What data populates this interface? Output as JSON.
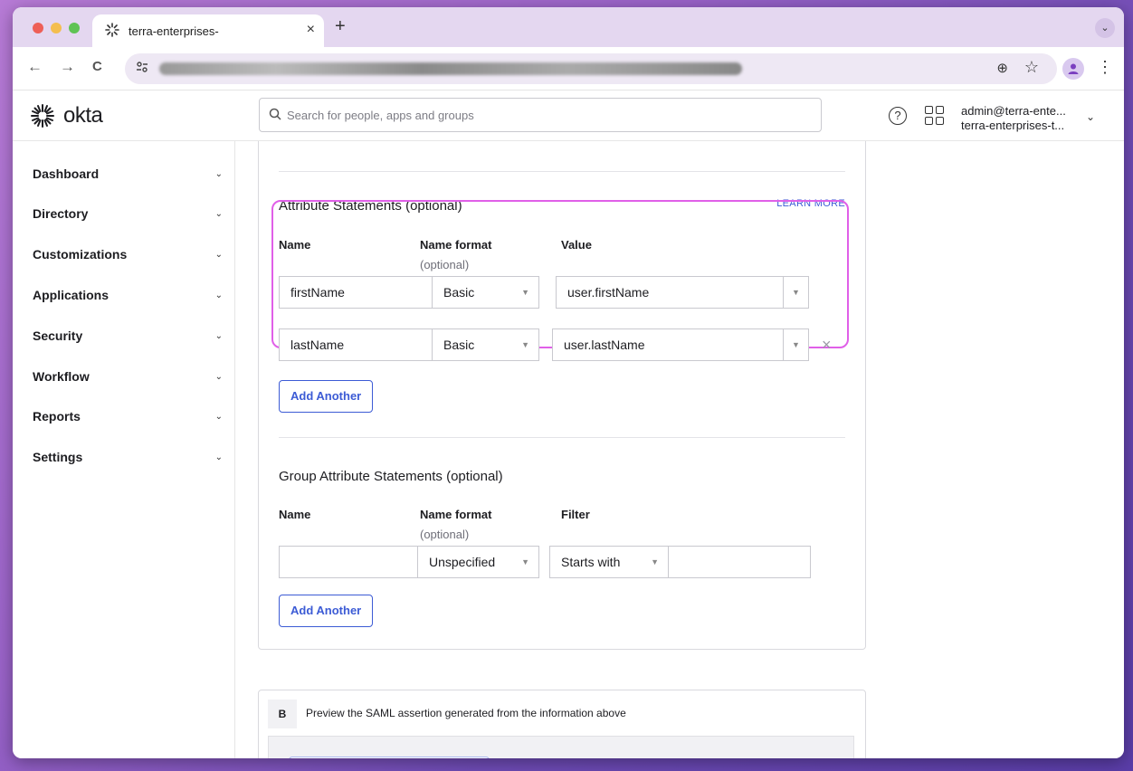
{
  "browser": {
    "tab_title": "terra-enterprises-",
    "tab_close": "×",
    "new_tab": "+",
    "tab_menu": "⌄",
    "back": "←",
    "forward": "→",
    "reload": "C",
    "zoom": "⊕",
    "star": "☆",
    "kebab": "⋮",
    "profile": "👤"
  },
  "header": {
    "logo_text": "okta",
    "search_placeholder": "Search for people, apps and groups",
    "search_value": "",
    "help": "?",
    "user_email": "admin@terra-ente...",
    "user_org": "terra-enterprises-t...",
    "chevron": "⌄"
  },
  "sidebar": {
    "items": [
      {
        "label": "Dashboard"
      },
      {
        "label": "Directory"
      },
      {
        "label": "Customizations"
      },
      {
        "label": "Applications"
      },
      {
        "label": "Security"
      },
      {
        "label": "Workflow"
      },
      {
        "label": "Reports"
      },
      {
        "label": "Settings"
      }
    ],
    "chevron": "⌄"
  },
  "attributes": {
    "title": "Attribute Statements (optional)",
    "learn_more": "LEARN MORE",
    "col_name": "Name",
    "col_format": "Name format",
    "col_format_sub": "(optional)",
    "col_value": "Value",
    "rows": [
      {
        "name": "firstName",
        "format": "Basic",
        "value": "user.firstName"
      },
      {
        "name": "lastName",
        "format": "Basic",
        "value": "user.lastName"
      }
    ],
    "remove": "×",
    "add_button": "Add Another"
  },
  "group_attributes": {
    "title": "Group Attribute Statements (optional)",
    "col_name": "Name",
    "col_format": "Name format",
    "col_format_sub": "(optional)",
    "col_filter": "Filter",
    "row": {
      "name": "",
      "format": "Unspecified",
      "filter": "Starts with",
      "filter_value": ""
    },
    "add_button": "Add Another"
  },
  "preview": {
    "badge": "B",
    "title": "Preview the SAML assertion generated from the information above"
  },
  "arrow": "▼",
  "colors": {
    "accent": "#3c5bd5",
    "highlight": "#e05fe8",
    "tab_bar": "#e4d7f0"
  }
}
